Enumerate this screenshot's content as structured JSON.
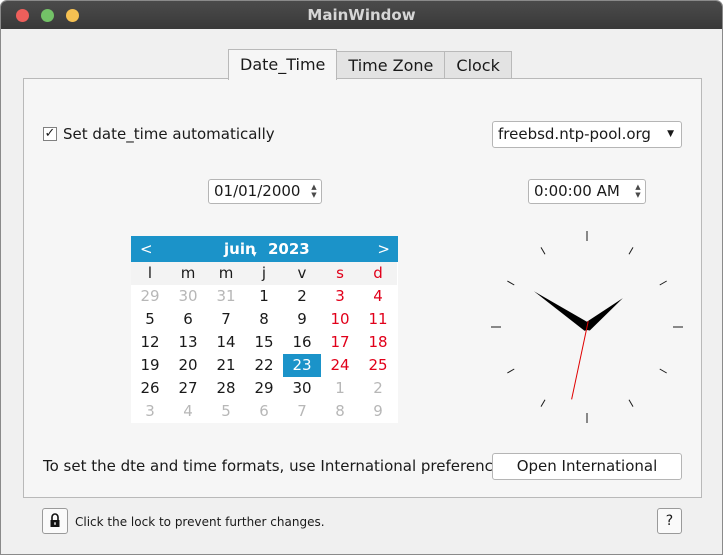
{
  "window": {
    "title": "MainWindow"
  },
  "tabs": [
    {
      "label": "Date_Time",
      "active": true
    },
    {
      "label": "Time Zone",
      "active": false
    },
    {
      "label": "Clock",
      "active": false
    }
  ],
  "auto_time": {
    "label": "Set date_time automatically",
    "checked": true,
    "check_glyph": "✓"
  },
  "ntp_server": {
    "value": "freebsd.ntp-pool.org"
  },
  "date_field": {
    "value": "01/01/2000"
  },
  "time_field": {
    "value": "0:00:00 AM"
  },
  "calendar": {
    "prev_glyph": "<",
    "next_glyph": ">",
    "month": "juin",
    "year": "2023",
    "weekdays": [
      "l",
      "m",
      "m",
      "j",
      "v",
      "s",
      "d"
    ],
    "weeks": [
      [
        "29",
        "30",
        "31",
        "1",
        "2",
        "3",
        "4"
      ],
      [
        "5",
        "6",
        "7",
        "8",
        "9",
        "10",
        "11"
      ],
      [
        "12",
        "13",
        "14",
        "15",
        "16",
        "17",
        "18"
      ],
      [
        "19",
        "20",
        "21",
        "22",
        "23",
        "24",
        "25"
      ],
      [
        "26",
        "27",
        "28",
        "29",
        "30",
        "1",
        "2"
      ],
      [
        "3",
        "4",
        "5",
        "6",
        "7",
        "8",
        "9"
      ]
    ],
    "other_month": [
      [
        true,
        true,
        true,
        false,
        false,
        false,
        false
      ],
      [
        false,
        false,
        false,
        false,
        false,
        false,
        false
      ],
      [
        false,
        false,
        false,
        false,
        false,
        false,
        false
      ],
      [
        false,
        false,
        false,
        false,
        false,
        false,
        false
      ],
      [
        false,
        false,
        false,
        false,
        false,
        true,
        true
      ],
      [
        true,
        true,
        true,
        true,
        true,
        true,
        true
      ]
    ],
    "selected_day": "23"
  },
  "clock": {
    "hours": 10,
    "minutes": 8,
    "seconds": 32
  },
  "footer": {
    "formats_text": "To set the dte and time formats, use International preferences.",
    "open_international": "Open International",
    "lock_text": "Click the lock to prevent further changes.",
    "help_label": "?"
  },
  "colors": {
    "accent": "#1b93c9",
    "weekend": "#e1001a",
    "other_month": "#b7b7b7",
    "second_hand": "#e00000"
  },
  "icons": {
    "lock": "lock-icon",
    "spin": "spin-arrows-icon",
    "dropdown": "chevron-down-icon"
  }
}
